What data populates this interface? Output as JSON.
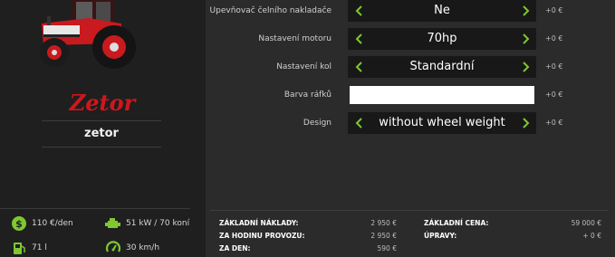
{
  "brand": {
    "logo_text": "Zetor",
    "name": "zetor"
  },
  "specs": [
    {
      "icon": "money-icon",
      "text": "110 €/den"
    },
    {
      "icon": "engine-icon",
      "text": "51 kW / 70 koní"
    },
    {
      "icon": "fuel-icon",
      "text": "71 l"
    },
    {
      "icon": "speedometer-icon",
      "text": "30 km/h"
    }
  ],
  "options": [
    {
      "label": "Upevňovač čelního nakladače",
      "value": "Ne",
      "price": "+0 €"
    },
    {
      "label": "Nastavení motoru",
      "value": "70hp",
      "price": "+0 €"
    },
    {
      "label": "Nastavení kol",
      "value": "Standardní",
      "price": "+0 €"
    },
    {
      "label": "Barva ráfků",
      "value": "",
      "color": "#ffffff",
      "price": "+0 €"
    },
    {
      "label": "Design",
      "value": "without wheel weight",
      "price": "+0 €"
    }
  ],
  "costs": {
    "base_costs_label": "ZÁKLADNÍ NÁKLADY:",
    "base_costs_value": "2 950 €",
    "per_hour_label": "ZA HODINU PROVOZU:",
    "per_hour_value": "2 950 €",
    "per_day_label": "ZA DEN:",
    "per_day_value": "590 €",
    "base_price_label": "ZÁKLADNÍ CENA:",
    "base_price_value": "59 000 €",
    "modifications_label": "ÚPRAVY:",
    "modifications_value": "+ 0 €"
  },
  "colors": {
    "accent": "#7ec832",
    "brand_red": "#d0161c",
    "left_panel_bg": "#1f1f1f",
    "main_bg": "#2b2b2b",
    "selector_bg": "#181818"
  }
}
